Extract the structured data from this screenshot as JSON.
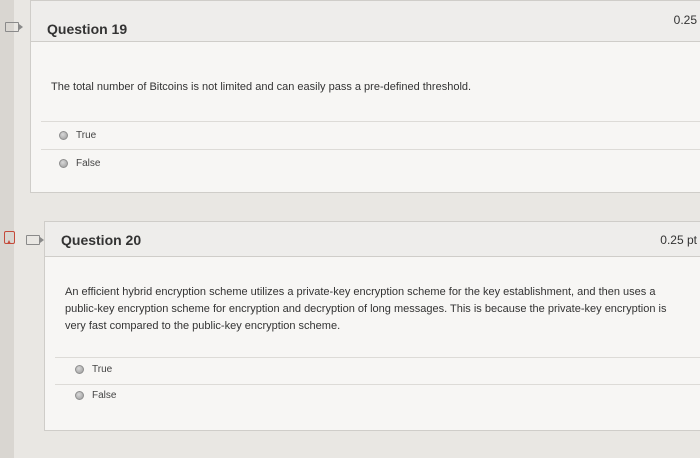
{
  "questions": [
    {
      "title": "Question 19",
      "points": "0.25",
      "text": "The total number of Bitcoins is not limited and can easily pass a pre-defined threshold.",
      "choices": [
        "True",
        "False"
      ]
    },
    {
      "title": "Question 20",
      "points": "0.25 pt",
      "text": "An efficient hybrid encryption scheme utilizes a private-key encryption scheme for the key establishment, and then uses a public-key encryption scheme for encryption and decryption of long messages. This is because the private-key encryption is very fast compared to the public-key encryption scheme.",
      "choices": [
        "True",
        "False"
      ]
    }
  ]
}
